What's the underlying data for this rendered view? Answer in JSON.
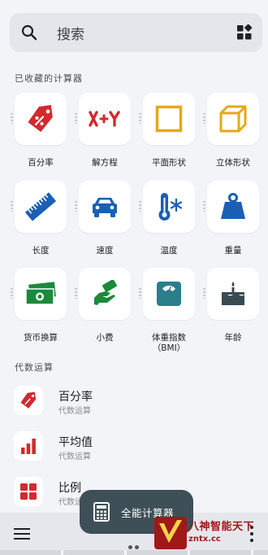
{
  "search": {
    "placeholder": "搜索"
  },
  "favorites": {
    "title": "已收藏的计算器",
    "items": [
      {
        "label": "百分率",
        "icon": "percent-tag-icon",
        "color": "#d12a2f"
      },
      {
        "label": "解方程",
        "icon": "x-plus-y-icon",
        "color": "#d12a2f"
      },
      {
        "label": "平面形状",
        "icon": "square-outline-icon",
        "color": "#e6a817"
      },
      {
        "label": "立体形状",
        "icon": "cube-outline-icon",
        "color": "#e6a817"
      },
      {
        "label": "长度",
        "icon": "ruler-icon",
        "color": "#1a5fb4"
      },
      {
        "label": "速度",
        "icon": "car-icon",
        "color": "#1a5fb4"
      },
      {
        "label": "温度",
        "icon": "thermometer-snow-icon",
        "color": "#1a5fb4"
      },
      {
        "label": "重量",
        "icon": "weight-icon",
        "color": "#1a5fb4"
      },
      {
        "label": "货币换算",
        "icon": "banknote-icon",
        "color": "#1b8a3a"
      },
      {
        "label": "小费",
        "icon": "tip-hand-icon",
        "color": "#1b8a3a"
      },
      {
        "label": "体重指数\n（BMI）",
        "icon": "bathroom-scale-icon",
        "color": "#2a7f8a"
      },
      {
        "label": "年龄",
        "icon": "birthday-cake-icon",
        "color": "#3a4a53"
      }
    ]
  },
  "algebra": {
    "title": "代数运算",
    "items": [
      {
        "name": "百分率",
        "category": "代数运算",
        "icon": "percent-tag-icon"
      },
      {
        "name": "平均值",
        "category": "代数运算",
        "icon": "bar-chart-icon"
      },
      {
        "name": "比例",
        "category": "代数运",
        "icon": "ratio-grid-icon"
      }
    ]
  },
  "fab": {
    "label": "全能计算器",
    "icon": "calculator-icon"
  },
  "watermark": {
    "main": "八神智能天下",
    "url": "zntx.cc"
  },
  "colors": {
    "red": "#d12a2f",
    "yellow": "#e6a817",
    "blue": "#1a5fb4",
    "green": "#1b8a3a",
    "teal": "#2a7f8a",
    "slate": "#3a4a53",
    "fab_bg": "#3e4f58",
    "page_bg": "#f3f4f8"
  }
}
